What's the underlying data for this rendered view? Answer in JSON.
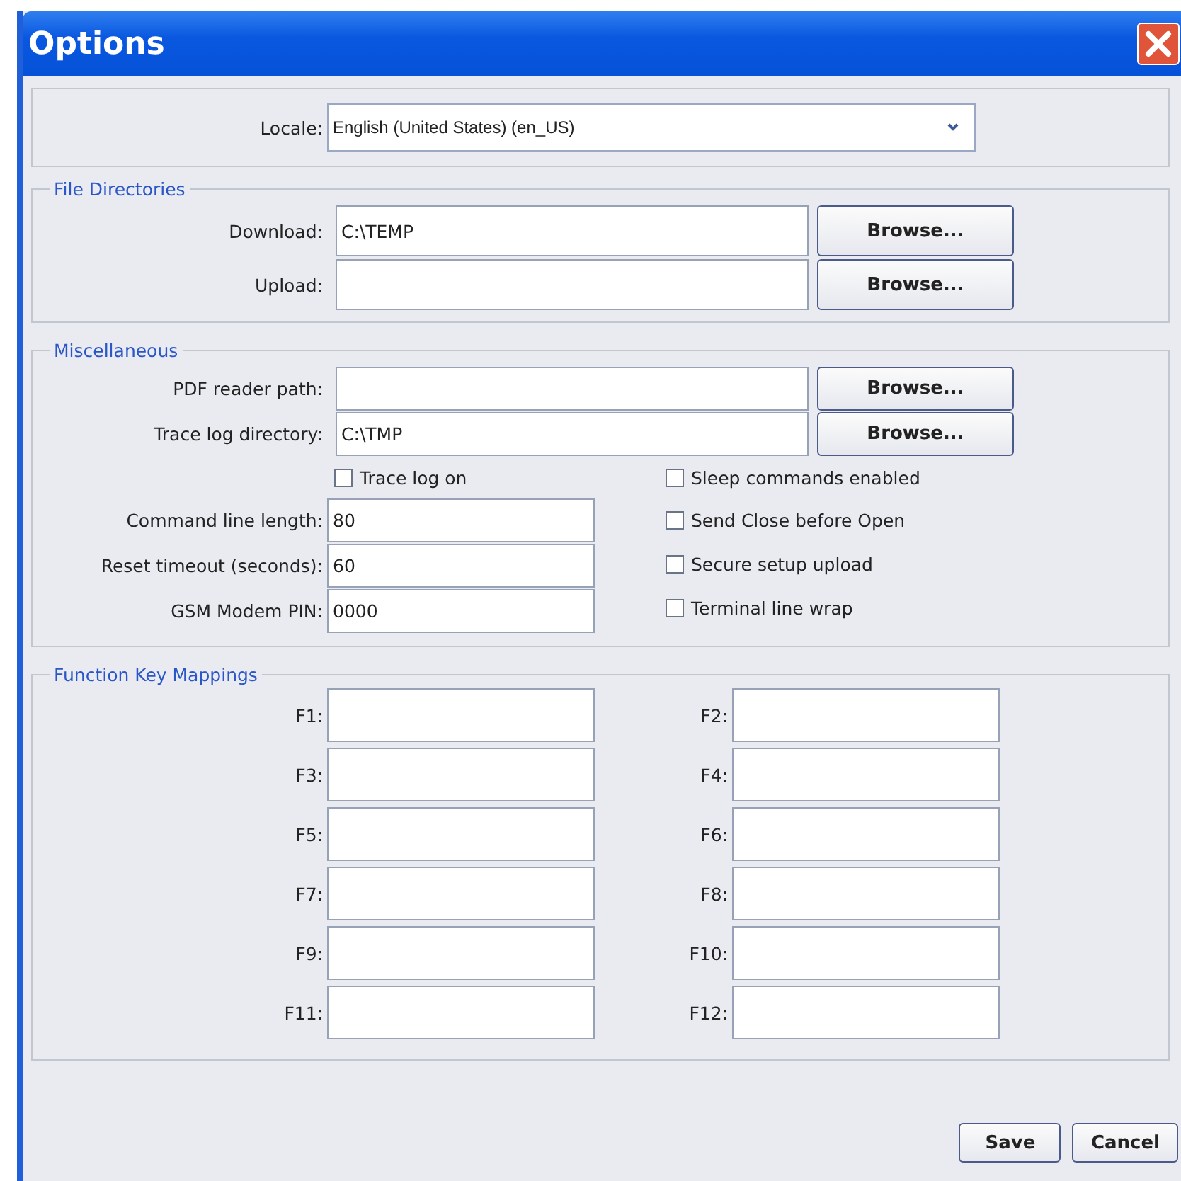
{
  "window": {
    "title": "Options"
  },
  "locale": {
    "label": "Locale:",
    "value": "English (United States) (en_US)"
  },
  "file_directories": {
    "title": "File Directories",
    "rows": [
      {
        "label": "Download:",
        "value": "C:\\TEMP",
        "button": "Browse..."
      },
      {
        "label": "Upload:",
        "button": "Browse..."
      }
    ]
  },
  "miscellaneous": {
    "title": "Miscellaneous",
    "paths": [
      {
        "label": "PDF reader path:",
        "button": "Browse..."
      },
      {
        "label": "Trace log directory:",
        "value": "C:\\TMP",
        "button": "Browse..."
      }
    ],
    "left_checkbox": {
      "label": "Trace log on",
      "checked": false
    },
    "fields": [
      {
        "label": "Command line length:",
        "value": "80"
      },
      {
        "label": "Reset timeout (seconds):",
        "value": "60"
      },
      {
        "label": "GSM Modem PIN:",
        "value": "0000"
      }
    ],
    "checkboxes": [
      {
        "label": "Sleep commands enabled",
        "checked": false
      },
      {
        "label": "Send Close before Open",
        "checked": false
      },
      {
        "label": "Secure setup upload",
        "checked": false
      },
      {
        "label": "Terminal line wrap",
        "checked": false
      }
    ]
  },
  "function_keys": {
    "title": "Function Key Mappings",
    "keys": [
      {
        "label": "F1:"
      },
      {
        "label": "F2:"
      },
      {
        "label": "F3:"
      },
      {
        "label": "F4:"
      },
      {
        "label": "F5:"
      },
      {
        "label": "F6:"
      },
      {
        "label": "F7:"
      },
      {
        "label": "F8:"
      },
      {
        "label": "F9:"
      },
      {
        "label": "F10:"
      },
      {
        "label": "F11:"
      },
      {
        "label": "F12:"
      }
    ]
  },
  "buttons": [
    "Save",
    "Cancel"
  ]
}
